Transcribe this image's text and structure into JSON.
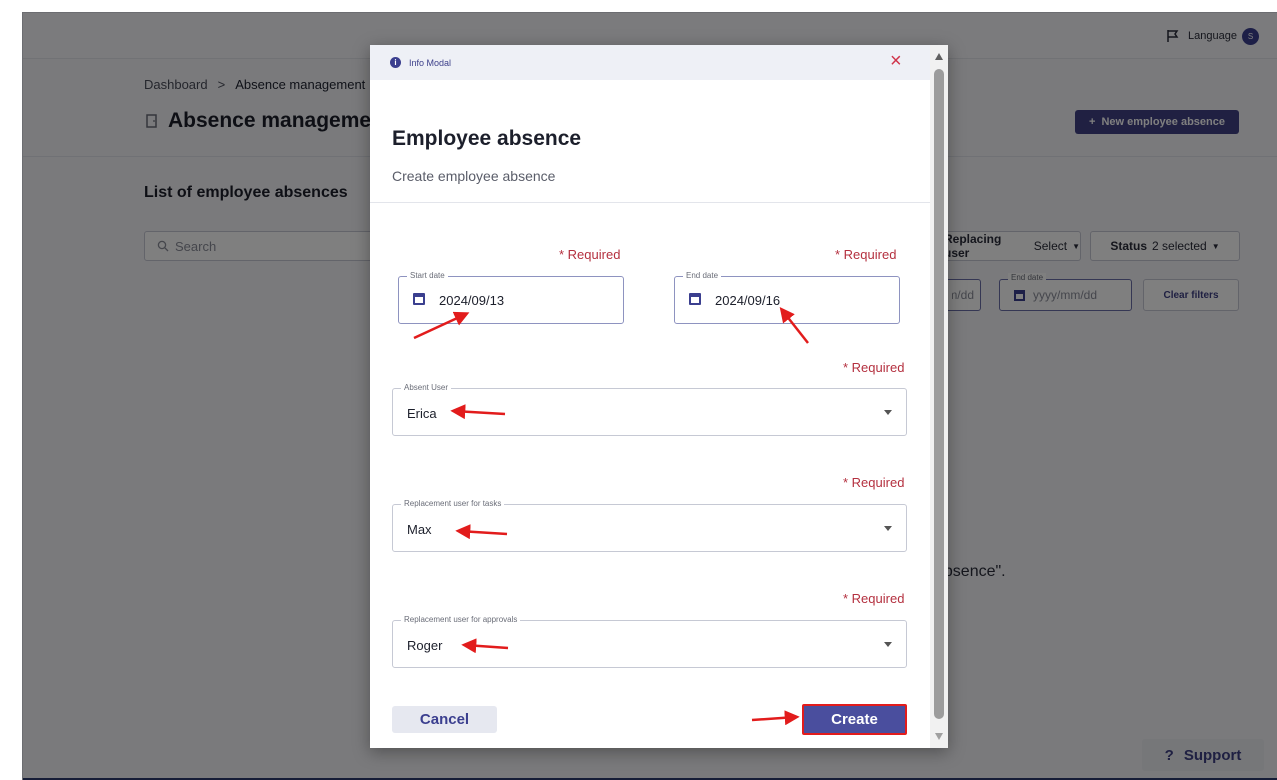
{
  "topbar": {
    "language_label": "Language",
    "avatar_initial": "S"
  },
  "breadcrumb": {
    "home": "Dashboard",
    "separator": ">",
    "current": "Absence management"
  },
  "page": {
    "title": "Absence management",
    "new_button": "New employee absence",
    "new_button_icon": "+",
    "list_title": "List of employee absences",
    "search_placeholder": "Search",
    "filter_user_label": "Replacing user",
    "filter_user_value": "Select",
    "filter_status_label": "Status",
    "filter_status_value": "2 selected",
    "filter_start_placeholder": "yyyy/mm/dd",
    "filter_end_label": "End date",
    "filter_end_placeholder": "yyyy/mm/dd",
    "clear_filters": "Clear filters",
    "empty_text": "absence\".",
    "support_label": "Support",
    "support_icon": "?"
  },
  "modal": {
    "header_label": "Info Modal",
    "close_icon": "×",
    "title": "Employee absence",
    "subtitle": "Create employee absence",
    "required_text": "* Required",
    "start_date": {
      "label": "Start date",
      "value": "2024/09/13"
    },
    "end_date": {
      "label": "End date",
      "value": "2024/09/16"
    },
    "absent_user": {
      "label": "Absent User",
      "value": "Erica"
    },
    "replacement_tasks": {
      "label": "Replacement user for tasks",
      "value": "Max"
    },
    "replacement_approvals": {
      "label": "Replacement user for approvals",
      "value": "Roger"
    },
    "cancel_label": "Cancel",
    "create_label": "Create"
  },
  "colors": {
    "primary": "#404185",
    "required": "#b4303f",
    "annotation_arrow": "#e21c1c",
    "overlay": "rgba(0,0,0,0.5)"
  }
}
